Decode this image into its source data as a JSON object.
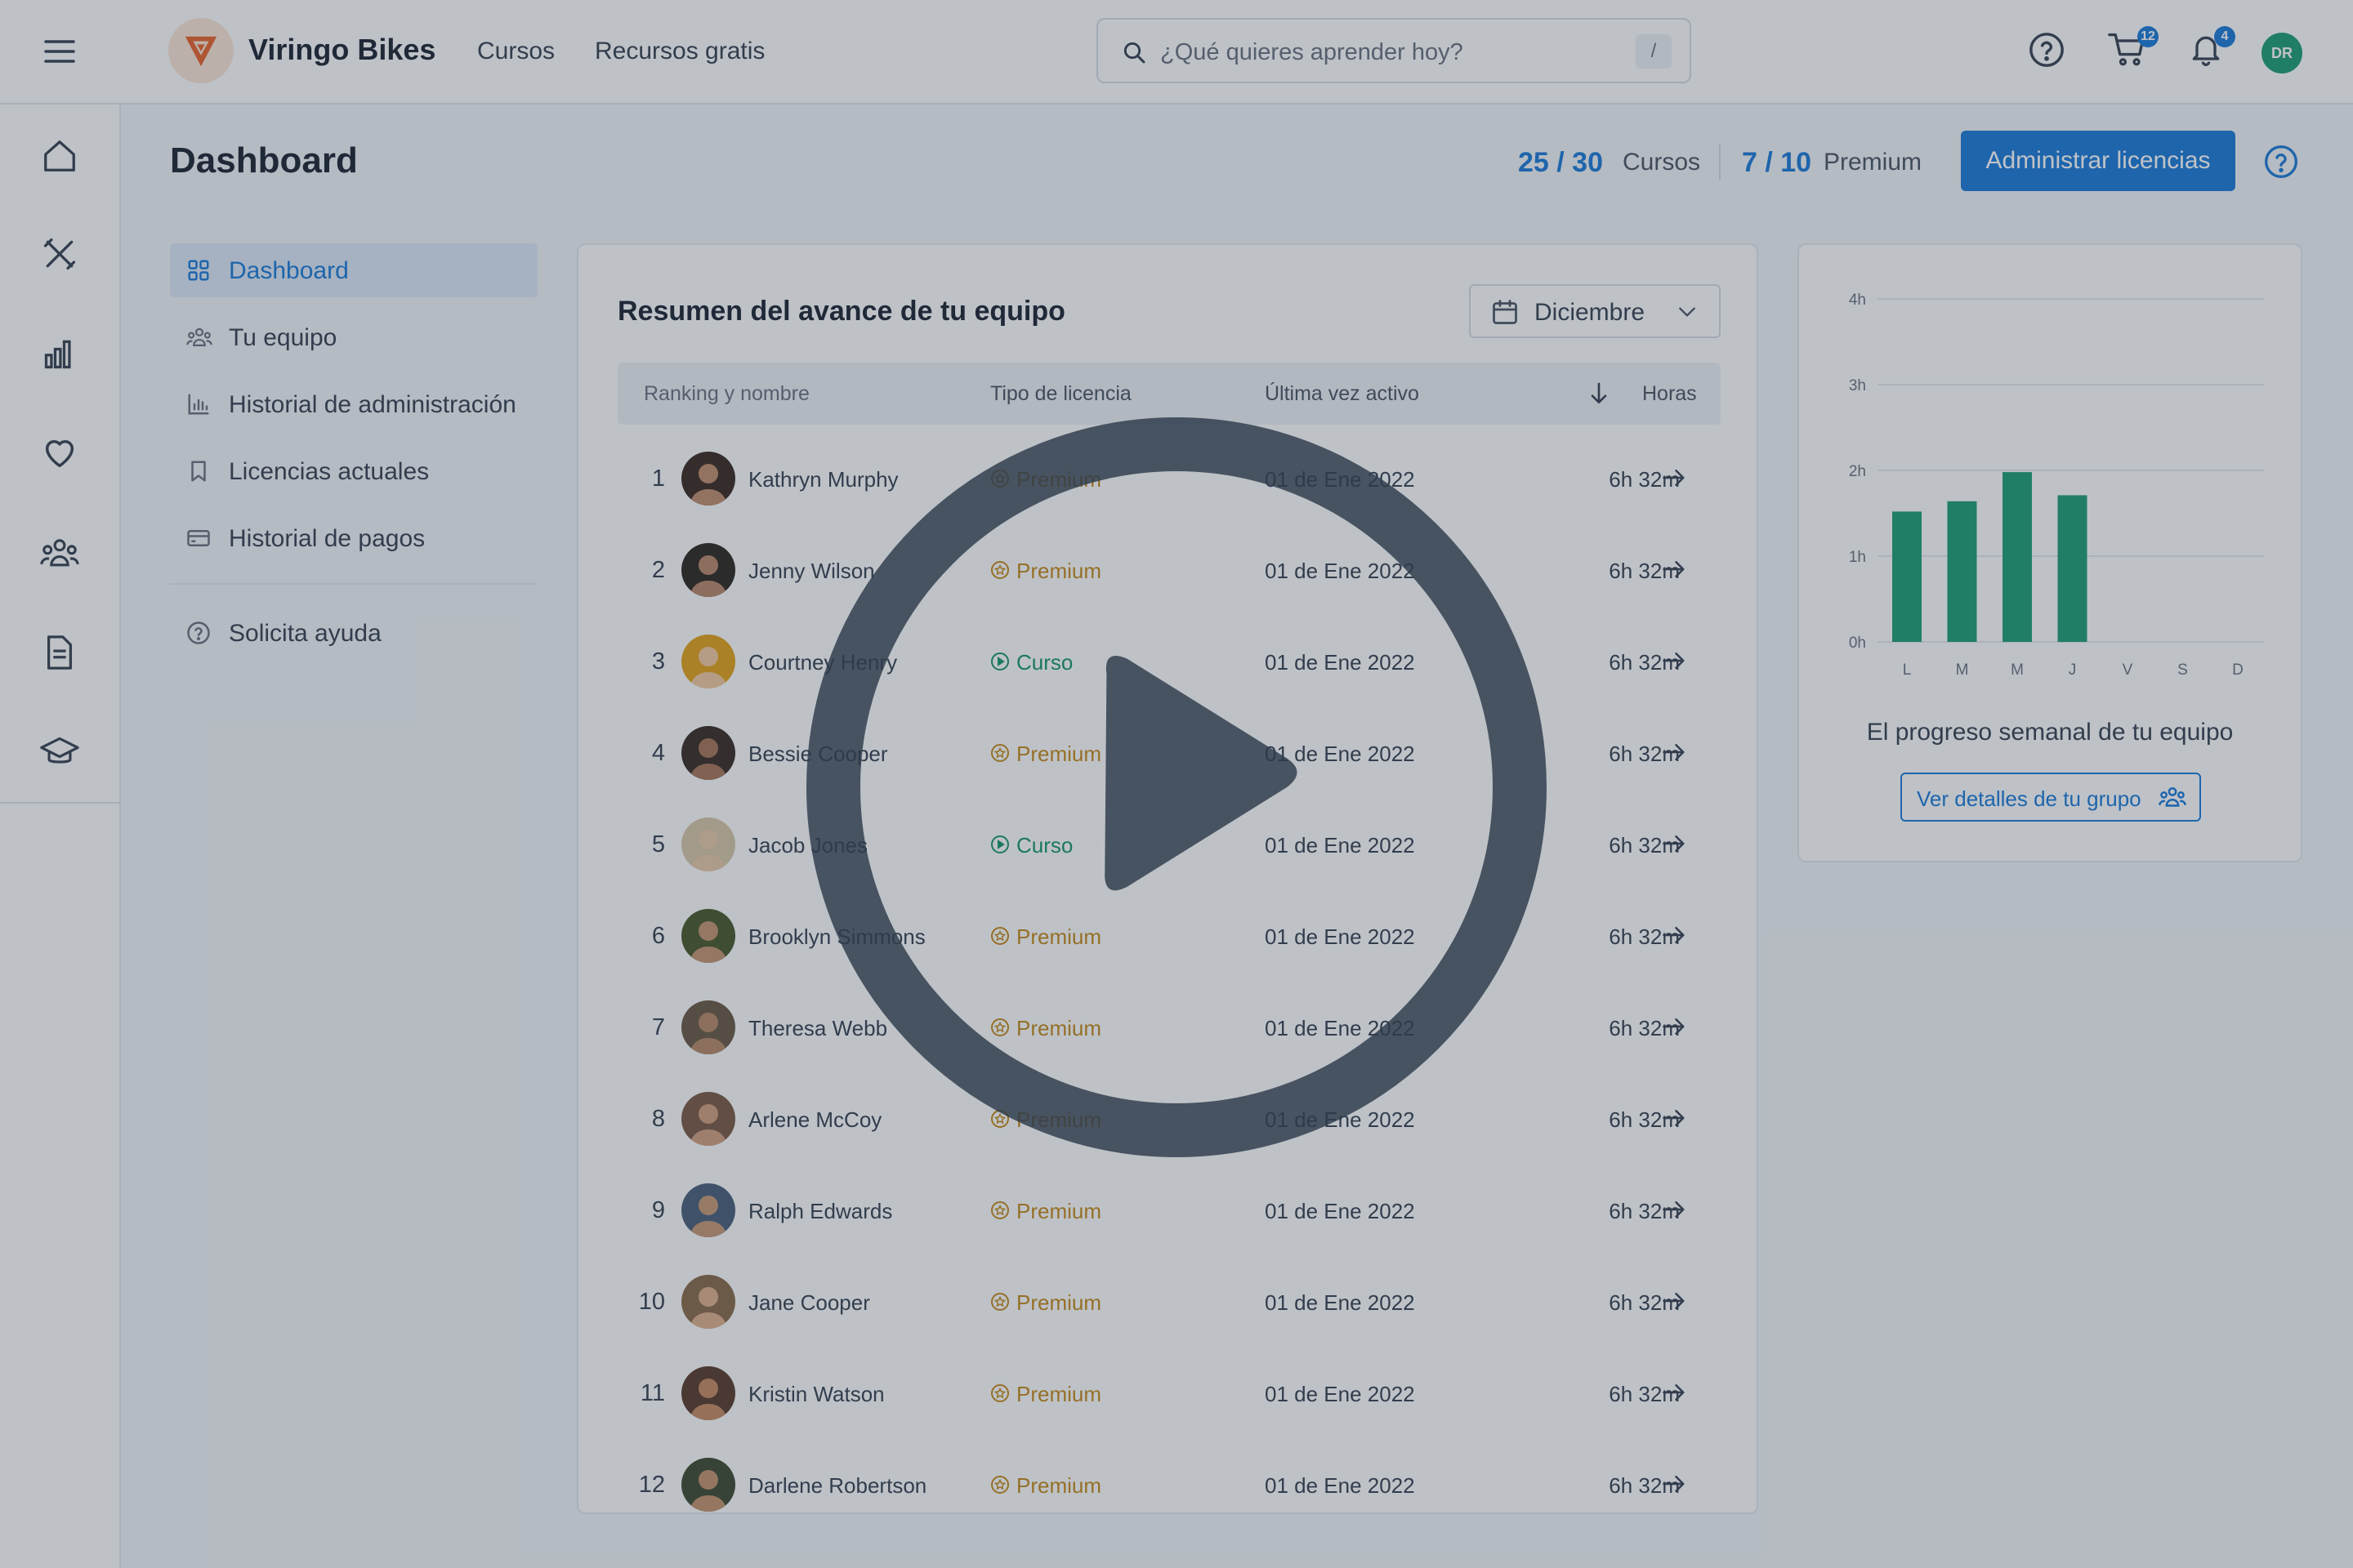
{
  "app": {
    "brand": "Viringo Bikes"
  },
  "nav": {
    "links": [
      "Cursos",
      "Recursos gratis"
    ]
  },
  "search": {
    "placeholder": "¿Qué quieres aprender hoy?",
    "shortcut": "/"
  },
  "header_icons": {
    "help": "help-circle-icon",
    "cart": "cart-icon",
    "bell": "bell-icon",
    "cart_badge": "12",
    "bell_badge": "4",
    "user_initials": "DR"
  },
  "rail": {
    "icons": [
      "menu-icon",
      "home-icon",
      "tools-icon",
      "bar-chart-icon",
      "heart-icon",
      "team-icon",
      "document-icon",
      "graduation-cap-icon"
    ]
  },
  "page": {
    "title": "Dashboard",
    "courses_count": "25 / 30",
    "courses_label": "Cursos",
    "premium_count": "7 / 10",
    "premium_label": "Premium",
    "manage_button": "Administrar licencias"
  },
  "sidebar": {
    "items": [
      {
        "label": "Dashboard",
        "icon": "grid-icon",
        "active": true
      },
      {
        "label": "Tu equipo",
        "icon": "team-icon"
      },
      {
        "label": "Historial de administración",
        "icon": "bar-chart-icon"
      },
      {
        "label": "Licencias actuales",
        "icon": "bookmark-icon"
      },
      {
        "label": "Historial de pagos",
        "icon": "credit-card-icon"
      }
    ],
    "help": {
      "label": "Solicita ayuda",
      "icon": "help-circle-icon"
    }
  },
  "team": {
    "title": "Resumen del avance de tu equipo",
    "month": "Diciembre",
    "columns": [
      "Ranking y nombre",
      "Tipo de licencia",
      "Última vez activo",
      "Horas"
    ],
    "rows": [
      {
        "rank": "1",
        "name": "Kathryn Murphy",
        "license": "Premium",
        "last_active": "01 de Ene 2022",
        "hours": "6h 32m"
      },
      {
        "rank": "2",
        "name": "Jenny Wilson",
        "license": "Premium",
        "last_active": "01 de Ene 2022",
        "hours": "6h 32m"
      },
      {
        "rank": "3",
        "name": "Courtney Henry",
        "license": "Curso",
        "last_active": "01 de Ene 2022",
        "hours": "6h 32m"
      },
      {
        "rank": "4",
        "name": "Bessie Cooper",
        "license": "Premium",
        "last_active": "01 de Ene 2022",
        "hours": "6h 32m"
      },
      {
        "rank": "5",
        "name": "Jacob Jones",
        "license": "Curso",
        "last_active": "01 de Ene 2022",
        "hours": "6h 32m"
      },
      {
        "rank": "6",
        "name": "Brooklyn Simmons",
        "license": "Premium",
        "last_active": "01 de Ene 2022",
        "hours": "6h 32m"
      },
      {
        "rank": "7",
        "name": "Theresa Webb",
        "license": "Premium",
        "last_active": "01 de Ene 2022",
        "hours": "6h 32m"
      },
      {
        "rank": "8",
        "name": "Arlene McCoy",
        "license": "Premium",
        "last_active": "01 de Ene 2022",
        "hours": "6h 32m"
      },
      {
        "rank": "9",
        "name": "Ralph Edwards",
        "license": "Premium",
        "last_active": "01 de Ene 2022",
        "hours": "6h 32m"
      },
      {
        "rank": "10",
        "name": "Jane Cooper",
        "license": "Premium",
        "last_active": "01 de Ene 2022",
        "hours": "6h 32m"
      },
      {
        "rank": "11",
        "name": "Kristin Watson",
        "license": "Premium",
        "last_active": "01 de Ene 2022",
        "hours": "6h 32m"
      },
      {
        "rank": "12",
        "name": "Darlene Robertson",
        "license": "Premium",
        "last_active": "01 de Ene 2022",
        "hours": "6h 32m"
      }
    ]
  },
  "weekly": {
    "caption": "El progreso semanal de tu equipo",
    "button": "Ver detalles de  tu grupo"
  },
  "chart_data": {
    "type": "bar",
    "categories": [
      "L",
      "M",
      "M",
      "J",
      "V",
      "S",
      "D"
    ],
    "values": [
      1.52,
      1.64,
      1.98,
      1.71,
      0,
      0,
      0
    ],
    "y_ticks": [
      "0h",
      "1h",
      "2h",
      "3h",
      "4h"
    ],
    "ylim": [
      0,
      4
    ],
    "grid": true,
    "color": "#1f9e74"
  },
  "overlay": {
    "icon": "play-icon"
  },
  "colors": {
    "accent": "#1a7ad8",
    "premium": "#c58a1a",
    "curso": "#17956c",
    "bar": "#1f9e74"
  }
}
